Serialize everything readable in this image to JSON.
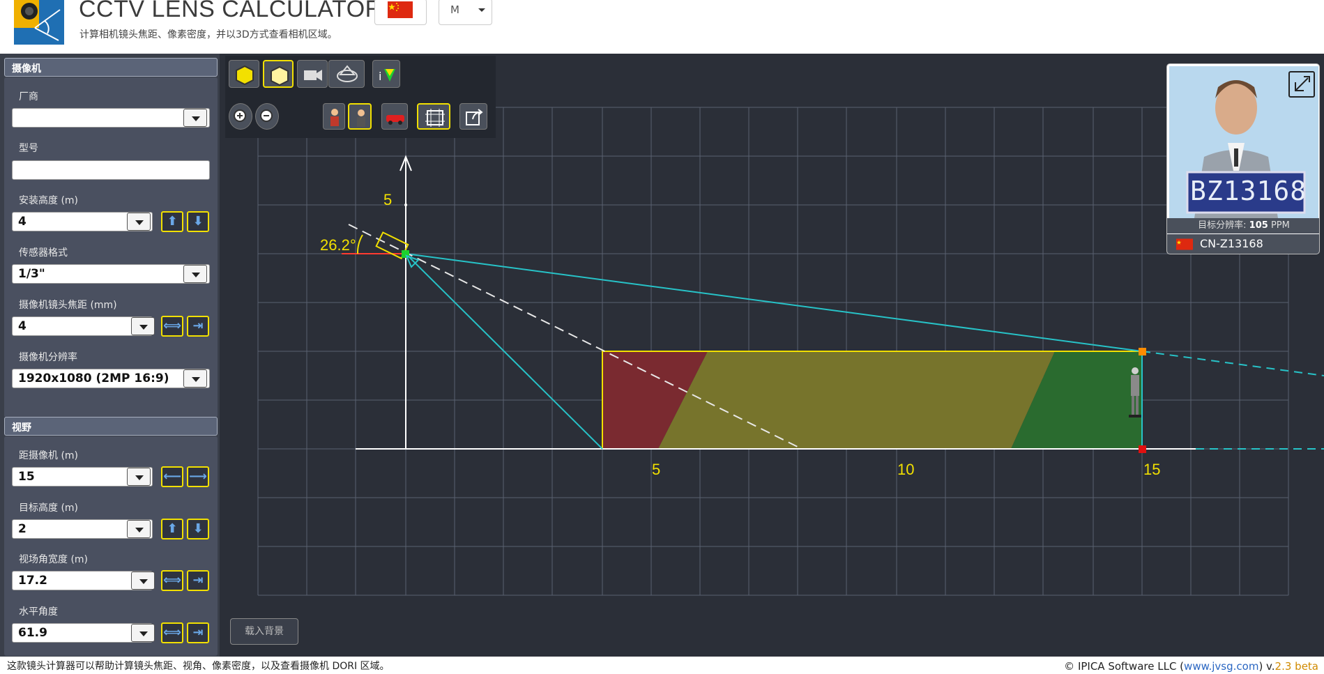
{
  "header": {
    "title": "CCTV LENS CALCULATOR",
    "subtitle": "计算相机镜头焦距、像素密度，并以3D方式查看相机区域。",
    "unit": "M"
  },
  "sections": {
    "camera": "摄像机",
    "view": "视野"
  },
  "fields": {
    "vendor": {
      "label": "厂商",
      "value": ""
    },
    "model": {
      "label": "型号",
      "value": ""
    },
    "mount_height": {
      "label": "安装高度 (m)",
      "value": "4"
    },
    "sensor": {
      "label": "传感器格式",
      "value": "1/3\""
    },
    "focal": {
      "label": "摄像机镜头焦距 (mm)",
      "value": "4"
    },
    "resolution": {
      "label": "摄像机分辨率",
      "value": "1920x1080 (2MP 16:9)"
    },
    "distance": {
      "label": "距摄像机 (m)",
      "value": "15"
    },
    "target_height": {
      "label": "目标高度 (m)",
      "value": "2"
    },
    "fov_width": {
      "label": "视场角宽度 (m)",
      "value": "17.2"
    },
    "h_angle": {
      "label": "水平角度",
      "value": "61.9"
    }
  },
  "canvas": {
    "angle_label": "26.2°",
    "y_tick": "5",
    "x_ticks": [
      "5",
      "10",
      "15"
    ],
    "load_bg": "载入背景"
  },
  "preview": {
    "plate_text": "BZ13168",
    "ppm_label": "目标分辨率:",
    "ppm_value": "105",
    "ppm_unit": "PPM",
    "plate_id": "CN-Z13168"
  },
  "footer": {
    "left": "这款镜头计算器可以帮助计算镜头焦距、视角、像素密度，以及查看摄像机 DORI 区域。",
    "copyright": "© IPICA Software LLC (",
    "site": "www.jvsg.com",
    "close": ") v.",
    "version": "2.3 beta"
  },
  "colors": {
    "accent_yellow": "#f2e000",
    "fov_line": "#27c3c8",
    "zone_red": "#7a2a30",
    "zone_yellow": "#77742c",
    "zone_green": "#2a6b2f"
  }
}
